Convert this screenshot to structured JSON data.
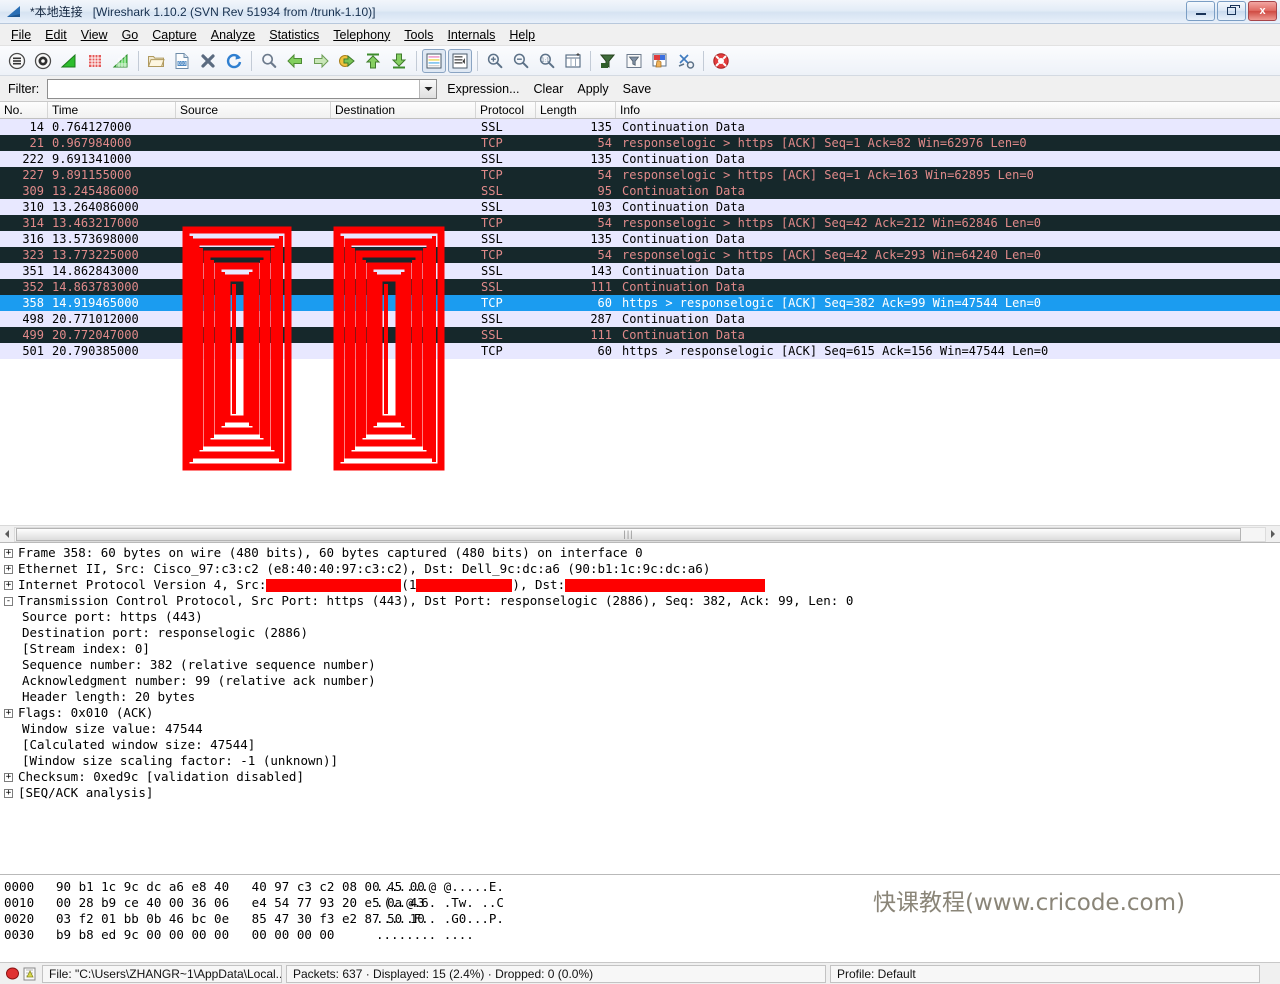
{
  "window": {
    "title_main": "*本地连接",
    "title_app": "[Wireshark 1.10.2  (SVN Rev 51934 from /trunk-1.10)]",
    "minimize_label": "Minimize",
    "maximize_label": "Restore",
    "close_label": "x"
  },
  "menu": {
    "items": [
      {
        "label": "File"
      },
      {
        "label": "Edit"
      },
      {
        "label": "View"
      },
      {
        "label": "Go"
      },
      {
        "label": "Capture"
      },
      {
        "label": "Analyze"
      },
      {
        "label": "Statistics"
      },
      {
        "label": "Telephony"
      },
      {
        "label": "Tools"
      },
      {
        "label": "Internals"
      },
      {
        "label": "Help"
      }
    ]
  },
  "toolbar": {
    "buttons": [
      {
        "name": "interfaces-icon",
        "title": "List available capture interfaces"
      },
      {
        "name": "capture-options-icon",
        "title": "Show capture options"
      },
      {
        "name": "start-capture-icon",
        "title": "Start a new live capture"
      },
      {
        "name": "stop-capture-icon",
        "title": "Stop the running live capture"
      },
      {
        "name": "restart-capture-icon",
        "title": "Restart the running live capture"
      },
      {
        "name": "open-file-icon",
        "title": "Open a capture file"
      },
      {
        "name": "save-file-icon",
        "title": "Save this capture file"
      },
      {
        "name": "close-file-icon",
        "title": "Close this capture file"
      },
      {
        "name": "reload-icon",
        "title": "Reload this capture file"
      },
      {
        "name": "find-packet-icon",
        "title": "Find a packet"
      },
      {
        "name": "go-back-icon",
        "title": "Go back in packet history"
      },
      {
        "name": "go-forward-icon",
        "title": "Go forward in packet history"
      },
      {
        "name": "go-to-packet-icon",
        "title": "Go to a specific packet"
      },
      {
        "name": "go-first-packet-icon",
        "title": "Go to the first packet"
      },
      {
        "name": "go-last-packet-icon",
        "title": "Go to the last packet"
      },
      {
        "name": "colorize-icon",
        "title": "Colorize packet list"
      },
      {
        "name": "auto-scroll-icon",
        "title": "Auto scroll in live capture"
      },
      {
        "name": "zoom-in-icon",
        "title": "Zoom in"
      },
      {
        "name": "zoom-out-icon",
        "title": "Zoom out"
      },
      {
        "name": "zoom-reset-icon",
        "title": "Zoom 1:1"
      },
      {
        "name": "resize-columns-icon",
        "title": "Resize columns"
      },
      {
        "name": "capture-filters-icon",
        "title": "Edit capture filters"
      },
      {
        "name": "display-filters-icon",
        "title": "Edit display filters"
      },
      {
        "name": "coloring-rules-icon",
        "title": "Edit coloring rules"
      },
      {
        "name": "preferences-icon",
        "title": "Edit preferences"
      },
      {
        "name": "help-icon",
        "title": "Show help"
      }
    ]
  },
  "filter": {
    "label": "Filter:",
    "value": "",
    "placeholder": "",
    "expression_label": "Expression...",
    "clear_label": "Clear",
    "apply_label": "Apply",
    "save_label": "Save"
  },
  "packet_list": {
    "columns": [
      "No.",
      "Time",
      "Source",
      "Destination",
      "Protocol",
      "Length",
      "Info"
    ],
    "rows": [
      {
        "no": "14",
        "time": "0.764127000",
        "source": "",
        "destination": "",
        "protocol": "SSL",
        "length": "135",
        "info": "Continuation Data",
        "style": "ssl"
      },
      {
        "no": "21",
        "time": "0.967984000",
        "source": "",
        "destination": "",
        "protocol": "TCP",
        "length": "54",
        "info": "responselogic > https [ACK] Seq=1 Ack=82 Win=62976 Len=0",
        "style": "tcp"
      },
      {
        "no": "222",
        "time": "9.691341000",
        "source": "",
        "destination": "",
        "protocol": "SSL",
        "length": "135",
        "info": "Continuation Data",
        "style": "ssl"
      },
      {
        "no": "227",
        "time": "9.891155000",
        "source": "",
        "destination": "",
        "protocol": "TCP",
        "length": "54",
        "info": "responselogic > https [ACK] Seq=1 Ack=163 Win=62895 Len=0",
        "style": "tcp"
      },
      {
        "no": "309",
        "time": "13.245486000",
        "source": "",
        "destination": "",
        "protocol": "SSL",
        "length": "95",
        "info": "Continuation Data",
        "style": "sslx"
      },
      {
        "no": "310",
        "time": "13.264086000",
        "source": "",
        "destination": "",
        "protocol": "SSL",
        "length": "103",
        "info": "Continuation Data",
        "style": "ssl"
      },
      {
        "no": "314",
        "time": "13.463217000",
        "source": "",
        "destination": "",
        "protocol": "TCP",
        "length": "54",
        "info": "responselogic > https [ACK] Seq=42 Ack=212 Win=62846 Len=0",
        "style": "tcp"
      },
      {
        "no": "316",
        "time": "13.573698000",
        "source": "",
        "destination": "",
        "protocol": "SSL",
        "length": "135",
        "info": "Continuation Data",
        "style": "ssl"
      },
      {
        "no": "323",
        "time": "13.773225000",
        "source": "",
        "destination": "",
        "protocol": "TCP",
        "length": "54",
        "info": "responselogic > https [ACK] Seq=42 Ack=293 Win=64240 Len=0",
        "style": "tcp"
      },
      {
        "no": "351",
        "time": "14.862843000",
        "source": "",
        "destination": "",
        "protocol": "SSL",
        "length": "143",
        "info": "Continuation Data",
        "style": "ssl"
      },
      {
        "no": "352",
        "time": "14.863783000",
        "source": "",
        "destination": "",
        "protocol": "SSL",
        "length": "111",
        "info": "Continuation Data",
        "style": "sslx"
      },
      {
        "no": "358",
        "time": "14.919465000",
        "source": "",
        "destination": "",
        "protocol": "TCP",
        "length": "60",
        "info": "https > responselogic [ACK] Seq=382 Ack=99 Win=47544 Len=0",
        "style": "selected"
      },
      {
        "no": "498",
        "time": "20.771012000",
        "source": "",
        "destination": "",
        "protocol": "SSL",
        "length": "287",
        "info": "Continuation Data",
        "style": "ssl"
      },
      {
        "no": "499",
        "time": "20.772047000",
        "source": "",
        "destination": "",
        "protocol": "SSL",
        "length": "111",
        "info": "Continuation Data",
        "style": "sslx"
      },
      {
        "no": "501",
        "time": "20.790385000",
        "source": "",
        "destination": "",
        "protocol": "TCP",
        "length": "60",
        "info": "https > responselogic [ACK] Seq=615 Ack=156 Win=47544 Len=0",
        "style": "ssl"
      }
    ]
  },
  "detail": {
    "lines": [
      {
        "twisty": "+",
        "indent": 0,
        "text": "Frame 358: 60 bytes on wire (480 bits), 60 bytes captured (480 bits) on interface 0"
      },
      {
        "twisty": "+",
        "indent": 0,
        "text": "Ethernet II, Src: Cisco_97:c3:c2 (e8:40:40:97:c3:c2), Dst: Dell_9c:dc:a6 (90:b1:1c:9c:dc:a6)"
      },
      {
        "twisty": "+",
        "indent": 0,
        "text": "Internet Protocol Version 4, Src: ",
        "redacted": true,
        "redacted_parts": [
          "Internet Protocol Version 4, Src: ",
          "(1",
          "), Dst: "
        ]
      },
      {
        "twisty": "-",
        "indent": 0,
        "text": "Transmission Control Protocol, Src Port: https (443), Dst Port: responselogic (2886), Seq: 382, Ack: 99, Len: 0"
      },
      {
        "twisty": "",
        "indent": 1,
        "text": "Source port: https (443)"
      },
      {
        "twisty": "",
        "indent": 1,
        "text": "Destination port: responselogic (2886)"
      },
      {
        "twisty": "",
        "indent": 1,
        "text": "[Stream index: 0]"
      },
      {
        "twisty": "",
        "indent": 1,
        "text": "Sequence number: 382    (relative sequence number)"
      },
      {
        "twisty": "",
        "indent": 1,
        "text": "Acknowledgment number: 99    (relative ack number)"
      },
      {
        "twisty": "",
        "indent": 1,
        "text": "Header length: 20 bytes"
      },
      {
        "twisty": "+",
        "indent": 0,
        "text": "Flags: 0x010 (ACK)"
      },
      {
        "twisty": "",
        "indent": 1,
        "text": "Window size value: 47544"
      },
      {
        "twisty": "",
        "indent": 1,
        "text": "[Calculated window size: 47544]"
      },
      {
        "twisty": "",
        "indent": 1,
        "text": "[Window size scaling factor: -1 (unknown)]"
      },
      {
        "twisty": "+",
        "indent": 0,
        "text": "Checksum: 0xed9c [validation disabled]"
      },
      {
        "twisty": "+",
        "indent": 0,
        "text": "[SEQ/ACK analysis]"
      }
    ]
  },
  "hexdump": {
    "lines": [
      {
        "offset": "0000",
        "bytes": "90 b1 1c 9c dc a6 e8 40   40 97 c3 c2 08 00 45 00",
        "ascii": ".......@ @.....E."
      },
      {
        "offset": "0010",
        "bytes": "00 28 b9 ce 40 00 36 06   e4 54 77 93 20 e5 0a 43",
        "ascii": ".(..@.6. .Tw. ..C"
      },
      {
        "offset": "0020",
        "bytes": "03 f2 01 bb 0b 46 bc 0e   85 47 30 f3 e2 87 50 10",
        "ascii": ".....F.. .G0...P."
      },
      {
        "offset": "0030",
        "bytes": "b9 b8 ed 9c 00 00 00 00   00 00 00 00",
        "ascii": "........ ...."
      }
    ],
    "watermark": "快课教程(www.cricode.com)"
  },
  "statusbar": {
    "file_text": "File: \"C:\\Users\\ZHANGR~1\\AppData\\Local...",
    "packets_text": "Packets: 637 · Displayed: 15 (2.4%) · Dropped: 0 (0.0%)",
    "profile_text": "Profile: Default"
  },
  "colors": {
    "ssl_row_bg": "#e8e8ff",
    "tcp_row_bg": "#16282b",
    "tcp_row_fg": "#e08a8a",
    "selected_bg": "#1b9cf0",
    "redaction": "#fe0000",
    "watermark": "#8a8578"
  }
}
